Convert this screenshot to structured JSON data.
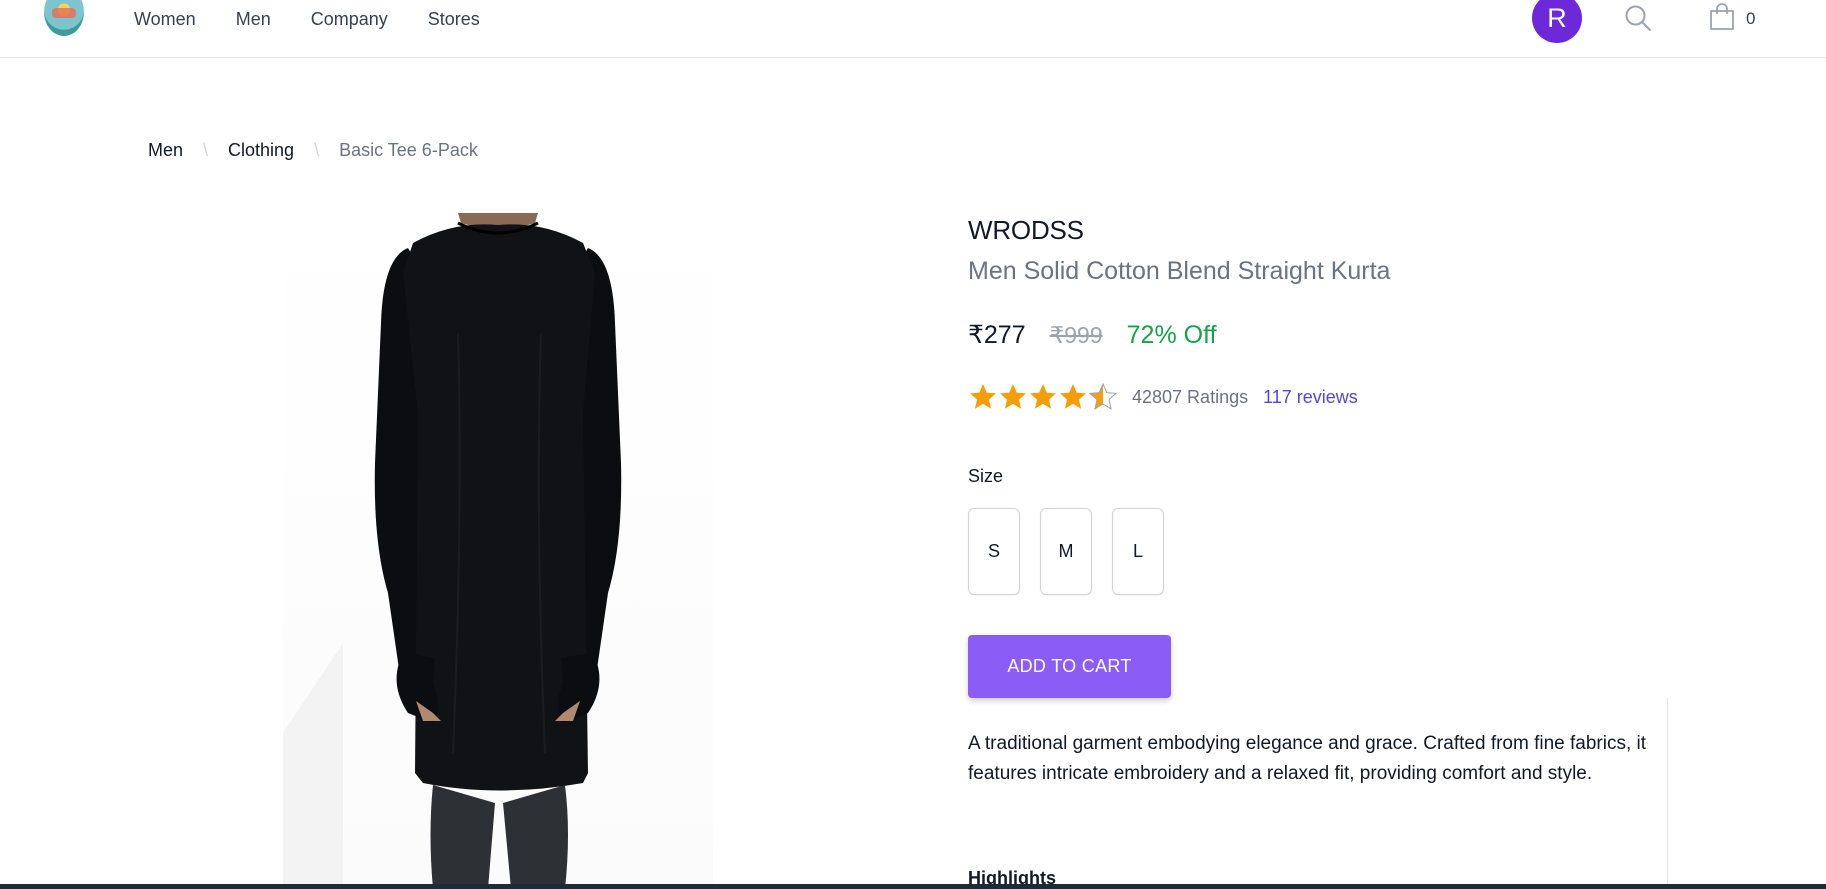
{
  "nav": {
    "links": [
      "Women",
      "Men",
      "Company",
      "Stores"
    ],
    "avatar_initial": "R",
    "cart_count": "0",
    "search_icon": "search-icon",
    "cart_icon": "shopping-bag-icon"
  },
  "breadcrumb": {
    "items": [
      "Men",
      "Clothing"
    ],
    "current": "Basic Tee 6-Pack"
  },
  "product": {
    "brand": "WRODSS",
    "title": "Men Solid Cotton Blend Straight Kurta",
    "price": "₹277",
    "mrp": "₹999",
    "discount": "72% Off",
    "rating_value": 4.5,
    "rating_max": 5,
    "ratings_count": "42807 Ratings",
    "reviews_link": "117 reviews",
    "size_label": "Size",
    "sizes": [
      "S",
      "M",
      "L"
    ],
    "add_to_cart": "ADD TO CART",
    "description": "A traditional garment embodying elegance and grace. Crafted from fine fabrics, it features intricate embroidery and a relaxed fit, providing comfort and style.",
    "highlights_title": "Highlights"
  },
  "colors": {
    "accent": "#8b5cf6",
    "avatar": "#6d28d9",
    "discount": "#16a34a",
    "link": "#4f46e5",
    "star": "#f59e0b"
  }
}
